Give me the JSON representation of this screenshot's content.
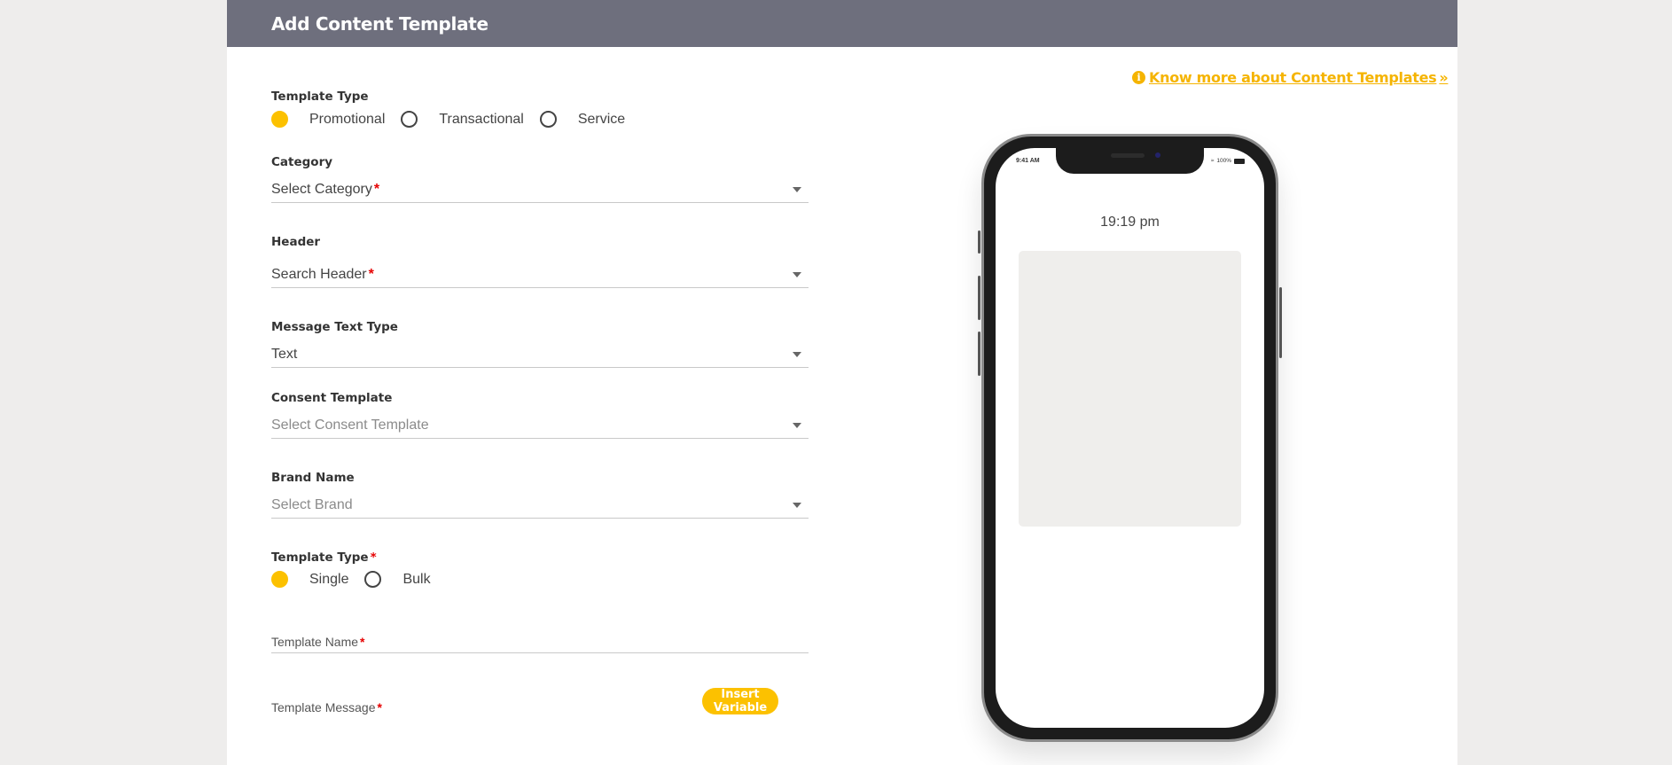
{
  "page": {
    "title": "Add Content Template",
    "know_more_link": "Know more about Content Templates",
    "know_more_icon": "info-circle-icon",
    "know_more_chevron": "double-chevron-right-icon"
  },
  "form": {
    "template_type": {
      "label": "Template Type",
      "options": [
        "Promotional",
        "Transactional",
        "Service"
      ],
      "selected": "Promotional"
    },
    "category": {
      "label": "Category",
      "placeholder": "Select Category",
      "required_mark": "*"
    },
    "header": {
      "label": "Header",
      "placeholder": "Search Header",
      "required_mark": "*"
    },
    "message_text_type": {
      "label": "Message Text Type",
      "value": "Text"
    },
    "consent_template": {
      "label": "Consent Template",
      "placeholder": "Select Consent Template"
    },
    "brand_name": {
      "label": "Brand Name",
      "placeholder": "Select Brand"
    },
    "template_type_2": {
      "label": "Template Type",
      "required_mark": "*",
      "options": [
        "Single",
        "Bulk"
      ],
      "selected": "Single"
    },
    "template_name": {
      "label": "Template Name",
      "required_mark": "*"
    },
    "template_message": {
      "label": "Template Message",
      "required_mark": "*"
    },
    "insert_variable_label": "Insert Variable"
  },
  "preview": {
    "status_time": "9:41 AM",
    "status_battery": "100%",
    "message_time": "19:19 pm"
  },
  "colors": {
    "accent": "#fcc100",
    "header_bg": "#6e6f7d",
    "page_bg": "#eeedec",
    "required": "#e60000"
  }
}
